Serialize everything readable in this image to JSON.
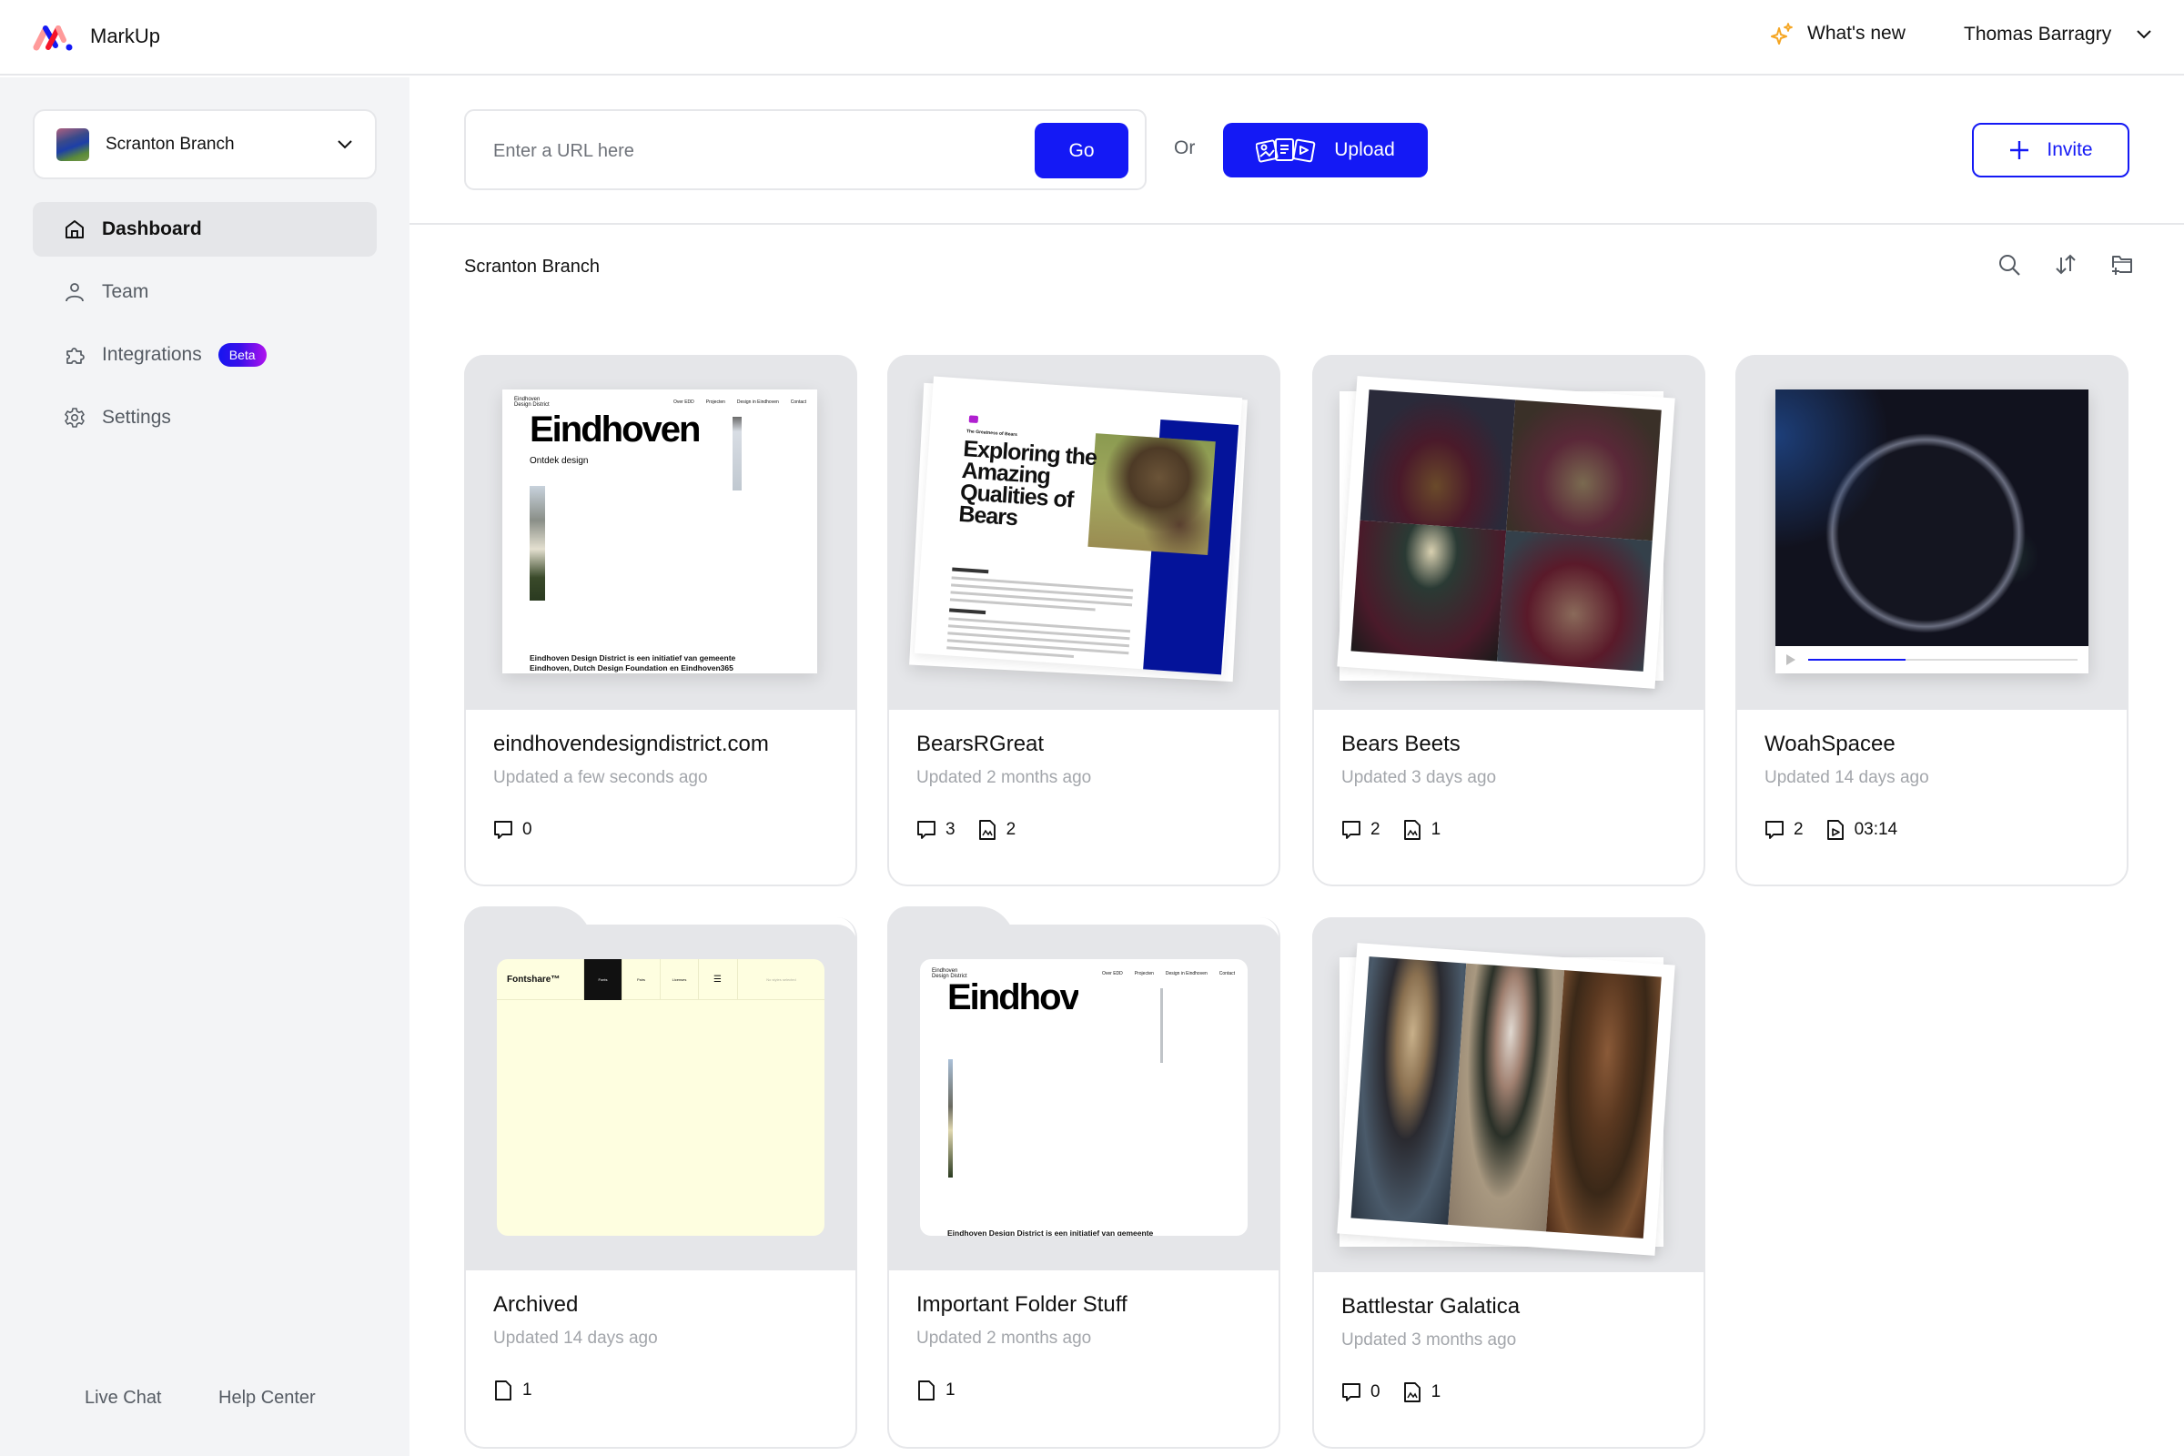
{
  "app": {
    "name": "MarkUp",
    "whats_new": "What's new",
    "user_name": "Thomas Barragry"
  },
  "sidebar": {
    "workspace": "Scranton Branch",
    "items": [
      {
        "label": "Dashboard",
        "icon": "home-icon",
        "active": true
      },
      {
        "label": "Team",
        "icon": "user-icon",
        "active": false
      },
      {
        "label": "Integrations",
        "icon": "puzzle-icon",
        "active": false,
        "badge": "Beta"
      },
      {
        "label": "Settings",
        "icon": "gear-icon",
        "active": false
      }
    ],
    "footer": {
      "live_chat": "Live Chat",
      "help_center": "Help Center"
    }
  },
  "toolbar": {
    "url_placeholder": "Enter a URL here",
    "url_value": "",
    "go_label": "Go",
    "or_label": "Or",
    "upload_label": "Upload",
    "invite_label": "Invite"
  },
  "section": {
    "title": "Scranton Branch",
    "tools": [
      "search-icon",
      "sort-icon",
      "new-folder-icon"
    ]
  },
  "colors": {
    "accent": "#1419f5",
    "sidebar_bg": "#f3f4f6",
    "active_nav_bg": "#e5e6e9",
    "muted_text": "#a3a6ab",
    "whats_new_icon": "#f5a623"
  },
  "cards": [
    {
      "title": "eindhovendesigndistrict.com",
      "updated": "Updated a few seconds ago",
      "type": "website",
      "comments": "0"
    },
    {
      "title": "BearsRGreat",
      "updated": "Updated 2 months ago",
      "type": "document",
      "comments": "3",
      "images": "2"
    },
    {
      "title": "Bears Beets",
      "updated": "Updated 3 days ago",
      "type": "image",
      "comments": "2",
      "images": "1"
    },
    {
      "title": "WoahSpacee",
      "updated": "Updated 14 days ago",
      "type": "video",
      "comments": "2",
      "duration": "03:14",
      "progress": 0.36
    },
    {
      "title": "Archived",
      "updated": "Updated 14 days ago",
      "type": "folder",
      "files": "1"
    },
    {
      "title": "Important Folder Stuff",
      "updated": "Updated 2 months ago",
      "type": "folder",
      "files": "1"
    },
    {
      "title": "Battlestar Galatica",
      "updated": "Updated 3 months ago",
      "type": "image",
      "comments": "0",
      "images": "1"
    }
  ],
  "thumbs": {
    "edd": {
      "logo_line1": "Eindhoven",
      "logo_line2": "Design District",
      "nav": [
        "Over EDD",
        "Projecten",
        "Design in Eindhoven",
        "Contact"
      ],
      "headline": "Eindhoven",
      "subhead": "Ontdek design",
      "footer_line1": "Eindhoven Design District is een initiatief van gemeente",
      "footer_line2": "Eindhoven, Dutch Design Foundation en Eindhoven365",
      "cut_headline": "Eindhov",
      "cut_footer": "Eindhoven Design District is een initiatief van gemeente"
    },
    "bears": {
      "kicker": "The Greatness of Bears",
      "headline": "Exploring the Amazing Qualities of Bears"
    },
    "fontshare": {
      "logo": "Fontshare™",
      "tabs": [
        "Fonts",
        "Pairs",
        "Licenses"
      ],
      "right": "No styles selected"
    }
  }
}
